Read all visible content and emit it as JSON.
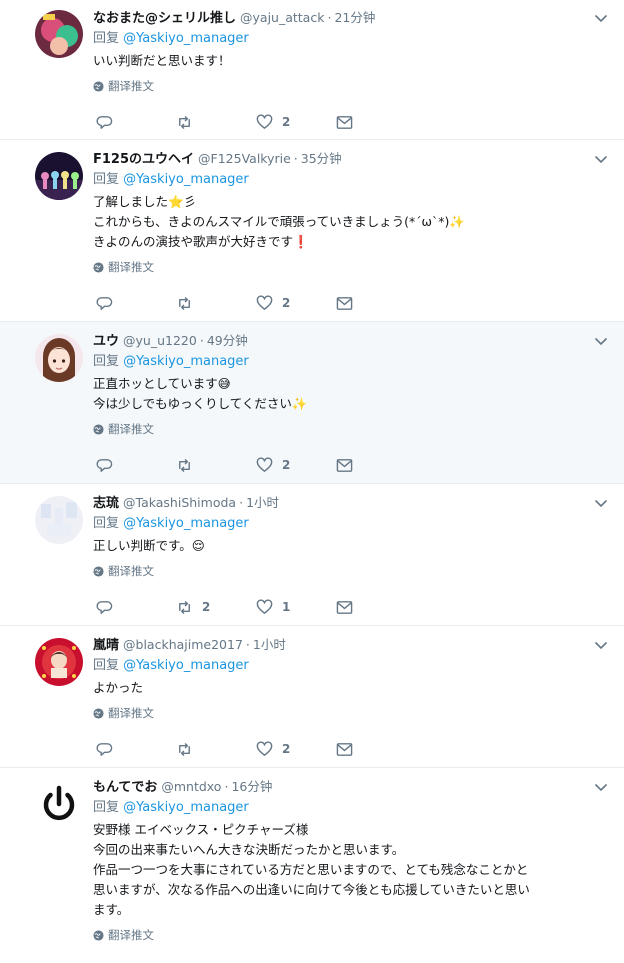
{
  "reply_prefix": "回复",
  "translate_label": "翻译推文",
  "tweets": [
    {
      "name": "なおまた@シェリル推し",
      "handle": "@yaju_attack",
      "time": "21分钟",
      "reply_to": "@Yaskiyo_manager",
      "text": "いい判断だと思います！",
      "replies": "",
      "retweets": "",
      "likes": "2"
    },
    {
      "name": "F125のユウヘイ",
      "handle": "@F125Valkyrie",
      "time": "35分钟",
      "reply_to": "@Yaskiyo_manager",
      "text": "了解しました⭐彡\nこれからも、きよのんスマイルで頑張っていきましょう(*´ω`*)✨\nきよのんの演技や歌声が大好きです❗",
      "replies": "",
      "retweets": "",
      "likes": "2"
    },
    {
      "name": "ユウ",
      "handle": "@yu_u1220",
      "time": "49分钟",
      "reply_to": "@Yaskiyo_manager",
      "text": "正直ホッとしています😅\n今は少しでもゆっくりしてください✨",
      "replies": "",
      "retweets": "",
      "likes": "2"
    },
    {
      "name": "志琉",
      "handle": "@TakashiShimoda",
      "time": "1小时",
      "reply_to": "@Yaskiyo_manager",
      "text": "正しい判断です。😌",
      "replies": "",
      "retweets": "2",
      "likes": "1"
    },
    {
      "name": "嵐晴",
      "handle": "@blackhajime2017",
      "time": "1小时",
      "reply_to": "@Yaskiyo_manager",
      "text": "よかった",
      "replies": "",
      "retweets": "",
      "likes": "2"
    },
    {
      "name": "もんてでお",
      "handle": "@mntdxo",
      "time": "16分钟",
      "reply_to": "@Yaskiyo_manager",
      "text": "安野様 エイベックス・ピクチャーズ様\n今回の出来事たいへん大きな決断だったかと思います。\n作品一つ一つを大事にされている方だと思いますので、とても残念なことかと\n思いますが、次なる作品への出逢いに向けて今後とも応援していきたいと思い\nます。",
      "replies": "",
      "retweets": "",
      "likes": ""
    }
  ]
}
